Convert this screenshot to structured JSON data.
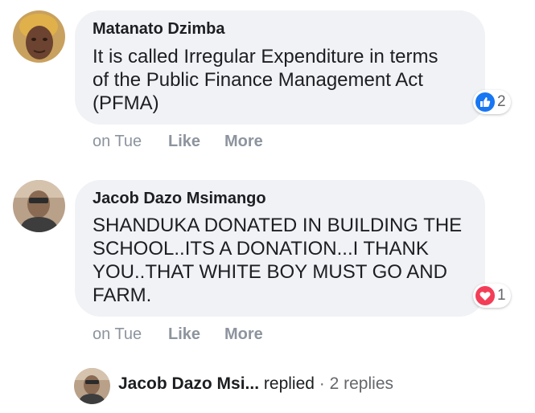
{
  "comments": [
    {
      "author": "Matanato Dzimba",
      "text": "It is called Irregular Expenditure in terms\nof the Public Finance Management Act\n(PFMA)",
      "reaction_icon": "like-icon",
      "reaction_color": "#1877f2",
      "reaction_count": "2",
      "time": "on Tue",
      "like_label": "Like",
      "more_label": "More"
    },
    {
      "author": "Jacob Dazo Msimango",
      "text": "SHANDUKA DONATED IN BUILDING THE\nSCHOOL..ITS A DONATION...I THANK\nYOU..THAT WHITE BOY MUST GO AND\nFARM.",
      "reaction_icon": "love-icon",
      "reaction_color": "#f33e58",
      "reaction_count": "1",
      "time": "on Tue",
      "like_label": "Like",
      "more_label": "More"
    }
  ],
  "reply_summary": {
    "name": "Jacob Dazo Msi...",
    "action": "replied",
    "separator": "·",
    "count": "2 replies"
  }
}
